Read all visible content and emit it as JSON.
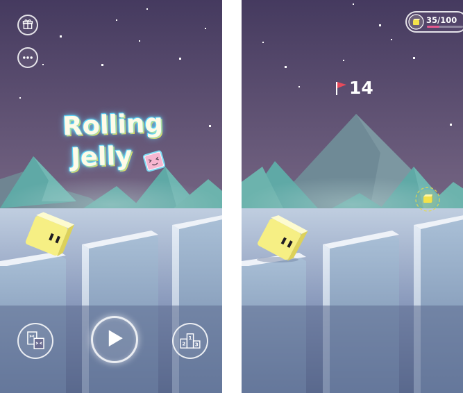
{
  "app": {
    "title_line1": "Rolling",
    "title_line2": "Jelly"
  },
  "menu_screen": {
    "top_buttons": [
      {
        "icon": "gift-icon"
      },
      {
        "icon": "more-icon"
      }
    ],
    "bottom_buttons": [
      {
        "icon": "skins-icon"
      },
      {
        "icon": "play-icon"
      },
      {
        "icon": "leaderboard-icon"
      }
    ],
    "leaderboard_ranks": [
      "2",
      "1",
      "3"
    ]
  },
  "game_screen": {
    "score": "14",
    "coins": {
      "text": "35/100",
      "progress": 0.35
    }
  },
  "colors": {
    "sky_top": "#453a5f",
    "sky_bottom": "#8a7896",
    "mountain_teal": "#5fa9a6",
    "jelly_yellow": "#f6ef84",
    "pillar_top": "#eef2f8",
    "pillar_face": "#8aa4be",
    "ground": "#5c6b8f",
    "flag_red": "#e64a5b",
    "coin_bar_pink": "#e3588e"
  }
}
